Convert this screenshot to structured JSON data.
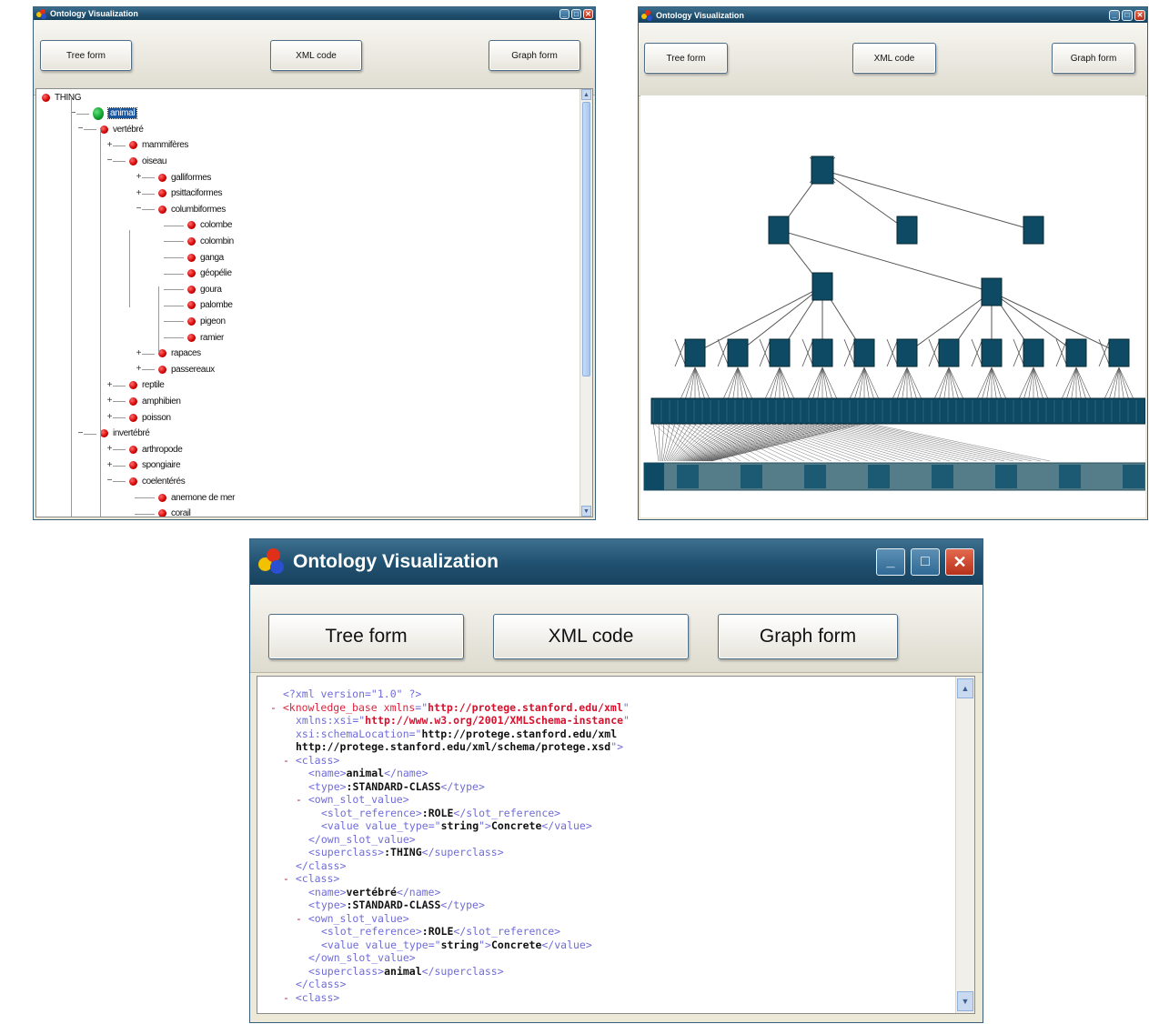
{
  "windows": {
    "tree": {
      "title": "Ontology Visualization",
      "buttons": {
        "tree": "Tree form",
        "xml": "XML code",
        "graph": "Graph form"
      },
      "tree_items": [
        {
          "label": "THING",
          "level": 0,
          "expander": ""
        },
        {
          "label": "animal",
          "level": 1,
          "expander": "−",
          "selected": true,
          "green": true
        },
        {
          "label": "vertébré",
          "level": 2,
          "expander": "−"
        },
        {
          "label": "mammifères",
          "level": 3,
          "expander": "+"
        },
        {
          "label": "oiseau",
          "level": 3,
          "expander": "−"
        },
        {
          "label": "galliformes",
          "level": 4,
          "expander": "+"
        },
        {
          "label": "psittaciformes",
          "level": 4,
          "expander": "+"
        },
        {
          "label": "columbiformes",
          "level": 4,
          "expander": "−"
        },
        {
          "label": "colombe",
          "level": 5,
          "expander": ""
        },
        {
          "label": "colombin",
          "level": 5,
          "expander": ""
        },
        {
          "label": "ganga",
          "level": 5,
          "expander": ""
        },
        {
          "label": "géopélie",
          "level": 5,
          "expander": ""
        },
        {
          "label": "goura",
          "level": 5,
          "expander": ""
        },
        {
          "label": "palombe",
          "level": 5,
          "expander": ""
        },
        {
          "label": "pigeon",
          "level": 5,
          "expander": ""
        },
        {
          "label": "ramier",
          "level": 5,
          "expander": ""
        },
        {
          "label": "rapaces",
          "level": 4,
          "expander": "+"
        },
        {
          "label": "passereaux",
          "level": 4,
          "expander": "+"
        },
        {
          "label": "reptile",
          "level": 3,
          "expander": "+"
        },
        {
          "label": "amphibien",
          "level": 3,
          "expander": "+"
        },
        {
          "label": "poisson",
          "level": 3,
          "expander": "+"
        },
        {
          "label": "invertébré",
          "level": 2,
          "expander": "−"
        },
        {
          "label": "arthropode",
          "level": 3,
          "expander": "+"
        },
        {
          "label": "spongiaire",
          "level": 3,
          "expander": "+"
        },
        {
          "label": "coelentérés",
          "level": 3,
          "expander": "−"
        },
        {
          "label": "anemone de mer",
          "level": 4,
          "expander": ""
        },
        {
          "label": "corail",
          "level": 4,
          "expander": ""
        }
      ]
    },
    "graph": {
      "title": "Ontology Visualization",
      "buttons": {
        "tree": "Tree form",
        "xml": "XML code",
        "graph": "Graph form"
      }
    },
    "xml": {
      "title": "Ontology Visualization",
      "buttons": {
        "tree": "Tree form",
        "xml": "XML code",
        "graph": "Graph form"
      },
      "lines": [
        {
          "indent": 0,
          "dash": false,
          "parts": [
            {
              "t": "<?xml version=\"1.0\" ?>",
              "c": "pi"
            }
          ]
        },
        {
          "indent": 0,
          "dash": true,
          "parts": [
            {
              "t": "<knowledge_base ",
              "c": "tag red"
            },
            {
              "t": "xmlns",
              "c": "attr red"
            },
            {
              "t": "=\"",
              "c": "punct"
            },
            {
              "t": "http://protege.stanford.edu/xml",
              "c": "val"
            },
            {
              "t": "\"",
              "c": "punct"
            }
          ]
        },
        {
          "indent": 2,
          "dash": false,
          "parts": [
            {
              "t": "xmlns:xsi",
              "c": "attr"
            },
            {
              "t": "=\"",
              "c": "punct"
            },
            {
              "t": "http://www.w3.org/2001/XMLSchema-instance",
              "c": "val"
            },
            {
              "t": "\"",
              "c": "punct"
            }
          ]
        },
        {
          "indent": 2,
          "dash": false,
          "parts": [
            {
              "t": "xsi:schemaLocation",
              "c": "attr"
            },
            {
              "t": "=\"",
              "c": "punct"
            },
            {
              "t": "http://protege.stanford.edu/xml",
              "c": "text"
            }
          ]
        },
        {
          "indent": 2,
          "dash": false,
          "parts": [
            {
              "t": "http://protege.stanford.edu/xml/schema/protege.xsd",
              "c": "text"
            },
            {
              "t": "\">",
              "c": "punct"
            }
          ]
        },
        {
          "indent": 2,
          "dash": true,
          "parts": [
            {
              "t": "<class>",
              "c": "tag"
            }
          ]
        },
        {
          "indent": 4,
          "dash": false,
          "parts": [
            {
              "t": "<name>",
              "c": "tag"
            },
            {
              "t": "animal",
              "c": "text"
            },
            {
              "t": "</name>",
              "c": "tag"
            }
          ]
        },
        {
          "indent": 4,
          "dash": false,
          "parts": [
            {
              "t": "<type>",
              "c": "tag"
            },
            {
              "t": ":STANDARD-CLASS",
              "c": "text"
            },
            {
              "t": "</type>",
              "c": "tag"
            }
          ]
        },
        {
          "indent": 4,
          "dash": true,
          "parts": [
            {
              "t": "<own_slot_value>",
              "c": "tag"
            }
          ]
        },
        {
          "indent": 6,
          "dash": false,
          "parts": [
            {
              "t": "<slot_reference>",
              "c": "tag"
            },
            {
              "t": ":ROLE",
              "c": "text"
            },
            {
              "t": "</slot_reference>",
              "c": "tag"
            }
          ]
        },
        {
          "indent": 6,
          "dash": false,
          "parts": [
            {
              "t": "<value ",
              "c": "tag"
            },
            {
              "t": "value_type",
              "c": "attr"
            },
            {
              "t": "=\"",
              "c": "punct"
            },
            {
              "t": "string",
              "c": "text"
            },
            {
              "t": "\">",
              "c": "punct"
            },
            {
              "t": "Concrete",
              "c": "text"
            },
            {
              "t": "</value>",
              "c": "tag"
            }
          ]
        },
        {
          "indent": 4,
          "dash": false,
          "parts": [
            {
              "t": "</own_slot_value>",
              "c": "tag"
            }
          ]
        },
        {
          "indent": 4,
          "dash": false,
          "parts": [
            {
              "t": "<superclass>",
              "c": "tag"
            },
            {
              "t": ":THING",
              "c": "text"
            },
            {
              "t": "</superclass>",
              "c": "tag"
            }
          ]
        },
        {
          "indent": 2,
          "dash": false,
          "parts": [
            {
              "t": "</class>",
              "c": "tag"
            }
          ]
        },
        {
          "indent": 2,
          "dash": true,
          "parts": [
            {
              "t": "<class>",
              "c": "tag"
            }
          ]
        },
        {
          "indent": 4,
          "dash": false,
          "parts": [
            {
              "t": "<name>",
              "c": "tag"
            },
            {
              "t": "vertébré",
              "c": "text"
            },
            {
              "t": "</name>",
              "c": "tag"
            }
          ]
        },
        {
          "indent": 4,
          "dash": false,
          "parts": [
            {
              "t": "<type>",
              "c": "tag"
            },
            {
              "t": ":STANDARD-CLASS",
              "c": "text"
            },
            {
              "t": "</type>",
              "c": "tag"
            }
          ]
        },
        {
          "indent": 4,
          "dash": true,
          "parts": [
            {
              "t": "<own_slot_value>",
              "c": "tag"
            }
          ]
        },
        {
          "indent": 6,
          "dash": false,
          "parts": [
            {
              "t": "<slot_reference>",
              "c": "tag"
            },
            {
              "t": ":ROLE",
              "c": "text"
            },
            {
              "t": "</slot_reference>",
              "c": "tag"
            }
          ]
        },
        {
          "indent": 6,
          "dash": false,
          "parts": [
            {
              "t": "<value ",
              "c": "tag"
            },
            {
              "t": "value_type",
              "c": "attr"
            },
            {
              "t": "=\"",
              "c": "punct"
            },
            {
              "t": "string",
              "c": "text"
            },
            {
              "t": "\">",
              "c": "punct"
            },
            {
              "t": "Concrete",
              "c": "text"
            },
            {
              "t": "</value>",
              "c": "tag"
            }
          ]
        },
        {
          "indent": 4,
          "dash": false,
          "parts": [
            {
              "t": "</own_slot_value>",
              "c": "tag"
            }
          ]
        },
        {
          "indent": 4,
          "dash": false,
          "parts": [
            {
              "t": "<superclass>",
              "c": "tag"
            },
            {
              "t": "animal",
              "c": "text"
            },
            {
              "t": "</superclass>",
              "c": "tag"
            }
          ]
        },
        {
          "indent": 2,
          "dash": false,
          "parts": [
            {
              "t": "</class>",
              "c": "tag"
            }
          ]
        },
        {
          "indent": 2,
          "dash": true,
          "parts": [
            {
              "t": "<class>",
              "c": "tag"
            }
          ]
        }
      ]
    }
  },
  "colors": {
    "titlebar": "#20506f",
    "graph_node": "#0e4a63",
    "node_dot": "#d00000",
    "xml_tag": "#6f6cd8",
    "xml_value": "#d8102c"
  }
}
